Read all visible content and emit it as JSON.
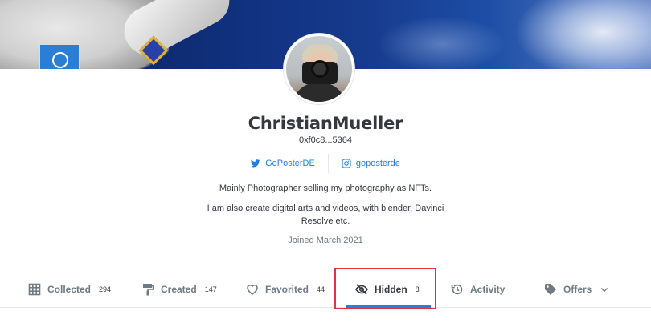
{
  "profile": {
    "username": "ChristianMueller",
    "address": "0xf0c8...5364",
    "twitter": "GoPosterDE",
    "instagram": "goposterde",
    "bio_line1": "Mainly Photographer selling my photography as NFTs.",
    "bio_line2": "I am also create digital arts and videos, with blender, Davinci Resolve etc.",
    "joined": "Joined March 2021"
  },
  "tabs": [
    {
      "label": "Collected",
      "count": "294",
      "icon": "grid-icon"
    },
    {
      "label": "Created",
      "count": "147",
      "icon": "paint-roller-icon"
    },
    {
      "label": "Favorited",
      "count": "44",
      "icon": "heart-icon"
    },
    {
      "label": "Hidden",
      "count": "8",
      "icon": "eye-off-icon",
      "active": true
    },
    {
      "label": "Activity",
      "count": "",
      "icon": "history-icon"
    },
    {
      "label": "Offers",
      "count": "",
      "icon": "tag-icon"
    }
  ],
  "colors": {
    "accent": "#2081e2",
    "text": "#353840",
    "muted": "#707a83",
    "highlight_box": "#e2343f"
  }
}
